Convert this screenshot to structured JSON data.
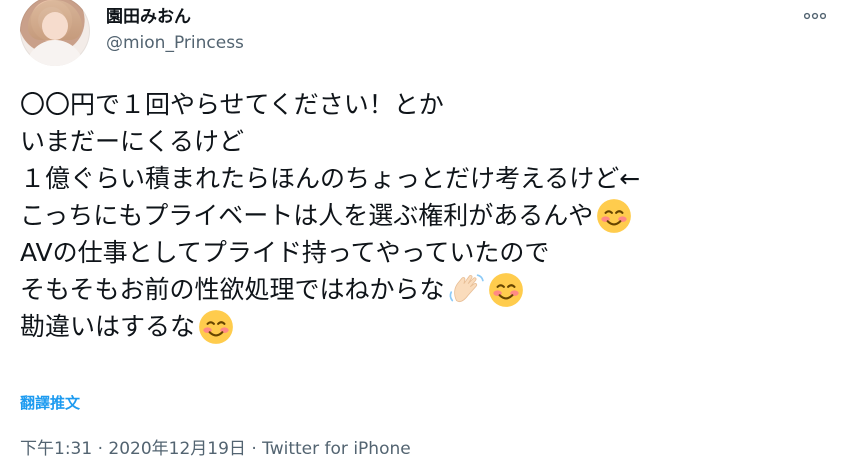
{
  "author": {
    "display_name": "園田みおん",
    "handle": "@mion_Princess"
  },
  "more_button": "more-icon",
  "tweet": {
    "lines": [
      {
        "text": "〇〇円で１回やらせてください！とか"
      },
      {
        "text": "いまだーにくるけど"
      },
      {
        "text": "１億ぐらい積まれたらほんのちょっとだけ考えるけど←"
      },
      {
        "text": "こっちにもプライベートは人を選ぶ権利があるんや",
        "emoji": [
          "smiling-face-emoji"
        ]
      },
      {
        "text": "AVの仕事としてプライド持ってやっていたので"
      },
      {
        "text": "そもそもお前の性欲処理ではねからな",
        "emoji": [
          "waving-hand-emoji",
          "smiling-face-emoji"
        ]
      },
      {
        "text": "勘違いはするな",
        "emoji": [
          "smiling-face-emoji"
        ]
      }
    ]
  },
  "translate_label": "翻譯推文",
  "meta": {
    "time": "下午1:31",
    "separator": "·",
    "date": "2020年12月19日",
    "source": "Twitter for iPhone"
  },
  "colors": {
    "link": "#1d9bf0",
    "muted": "#536471",
    "text": "#0f1419"
  }
}
